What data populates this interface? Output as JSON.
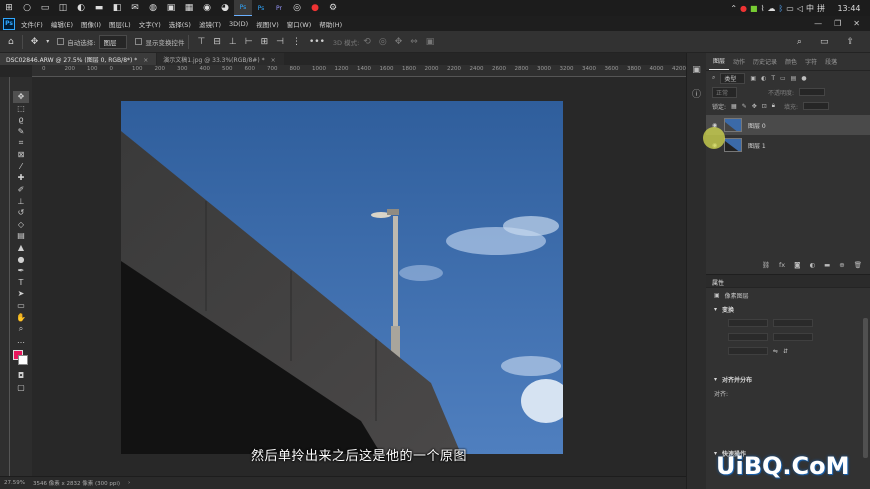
{
  "taskbar": {
    "icons": [
      "windows-icon",
      "search-icon",
      "taskview-icon",
      "widgets-icon",
      "edge-icon",
      "folder-icon",
      "store-icon",
      "mail-icon",
      "wechat-icon",
      "photos-icon",
      "wps-icon",
      "chrome-icon",
      "firefox-icon",
      "photoshop-icon",
      "photoshop-icon",
      "premiere-icon",
      "media-icon",
      "recorder-icon",
      "settings-icon"
    ],
    "tray_lang": "中",
    "tray_ime": "拼",
    "clock": "13:44"
  },
  "menubar": {
    "logo": "Ps",
    "items": [
      "文件(F)",
      "编辑(E)",
      "图像(I)",
      "图层(L)",
      "文字(Y)",
      "选择(S)",
      "滤镜(T)",
      "3D(D)",
      "视图(V)",
      "窗口(W)",
      "帮助(H)"
    ]
  },
  "options": {
    "auto_select_label": "自动选择:",
    "auto_select_value": "图层",
    "show_transform_label": "显示变换控件",
    "mode_3d_label": "3D 模式:"
  },
  "tabs": [
    {
      "label": "DSC02846.ARW @ 27.5% (图层 0, RGB/8*) *",
      "active": true
    },
    {
      "label": "演示文稿1.jpg @ 33.3%(RGB/8#) *",
      "active": false
    }
  ],
  "ruler_top_labels": [
    "0",
    "200",
    "100",
    "0",
    "100",
    "200",
    "300",
    "400",
    "500",
    "600",
    "700",
    "800",
    "1000",
    "1200",
    "1400",
    "1600",
    "1800",
    "2000",
    "2200",
    "2400",
    "2600",
    "2800",
    "3000",
    "3200",
    "3400",
    "3600",
    "3800",
    "4000",
    "4200"
  ],
  "canvas": {
    "subtitle": "然后单拎出来之后这是他的一个原图"
  },
  "layers_panel": {
    "tabs": [
      "图层",
      "动作",
      "历史记录",
      "颜色",
      "字符",
      "段落"
    ],
    "filter_label": "类型",
    "blend_mode": "正常",
    "opacity_label": "不透明度:",
    "lock_label": "锁定:",
    "fill_label": "填充:",
    "layers": [
      {
        "name": "图层 0",
        "selected": true
      },
      {
        "name": "图层 1",
        "selected": false
      }
    ]
  },
  "properties_panel": {
    "title": "属性",
    "subtitle": "像素图层",
    "transform_label": "变换",
    "align_label": "对齐并分布",
    "align_sub": "对齐:",
    "quick_actions_label": "快速操作"
  },
  "statusbar": {
    "zoom": "27.59%",
    "dimensions": "3546 像素 x 2832 像素 (300 ppi)"
  },
  "watermark": "UiBQ.CoM",
  "colors": {
    "foreground": "#e8175d",
    "background": "#ffffff",
    "sky": "#3b6aa8",
    "ps_blue": "#31a8ff"
  }
}
